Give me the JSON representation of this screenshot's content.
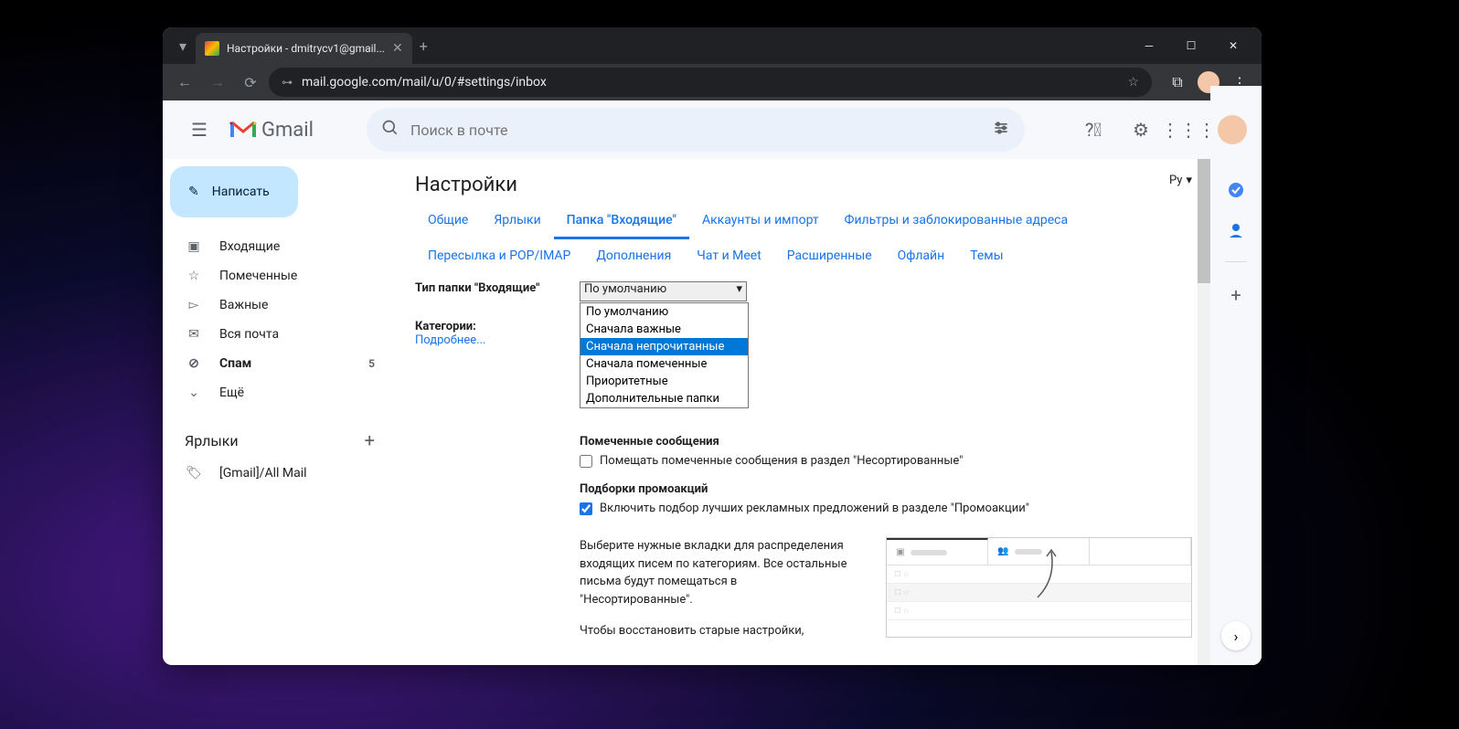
{
  "browser": {
    "tab_title": "Настройки - dmitrycv1@gmail...",
    "url": "mail.google.com/mail/u/0/#settings/inbox"
  },
  "header": {
    "product": "Gmail",
    "search_placeholder": "Поиск в почте"
  },
  "sidebar": {
    "compose": "Написать",
    "items": [
      {
        "icon": "inbox",
        "label": "Входящие"
      },
      {
        "icon": "star",
        "label": "Помеченные"
      },
      {
        "icon": "tag",
        "label": "Важные"
      },
      {
        "icon": "mail",
        "label": "Вся почта"
      },
      {
        "icon": "spam",
        "label": "Спам",
        "count": "5",
        "bold": true
      },
      {
        "icon": "more",
        "label": "Ещё"
      }
    ],
    "labels_header": "Ярлыки",
    "labels": [
      {
        "label": "[Gmail]/All Mail"
      }
    ]
  },
  "settings": {
    "title": "Настройки",
    "lang": "Ру",
    "tabs": [
      "Общие",
      "Ярлыки",
      "Папка \"Входящие\"",
      "Аккаунты и импорт",
      "Фильтры и заблокированные адреса",
      "Пересылка и POP/IMAP",
      "Дополнения",
      "Чат и Meet",
      "Расширенные",
      "Офлайн",
      "Темы"
    ],
    "active_tab": 2,
    "inbox_type_label": "Тип папки \"Входящие\"",
    "select_value": "По умолчанию",
    "dropdown_options": [
      "По умолчанию",
      "Сначала важные",
      "Сначала непрочитанные",
      "Сначала помеченные",
      "Приоритетные",
      "Дополнительные папки"
    ],
    "dropdown_highlighted": 2,
    "categories_label": "Категории:",
    "categories_more": "Подробнее...",
    "starred_head": "Помеченные сообщения",
    "starred_check": "Помещать помеченные сообщения в раздел \"Несортированные\"",
    "promo_head": "Подборки промоакций",
    "promo_check": "Включить подбор лучших рекламных предложений в разделе \"Промоакции\"",
    "desc1": "Выберите нужные вкладки для распределения входящих писем по категориям. Все остальные письма будут помещаться в \"Несортированные\".",
    "desc2": "Чтобы восстановить старые настройки,"
  }
}
